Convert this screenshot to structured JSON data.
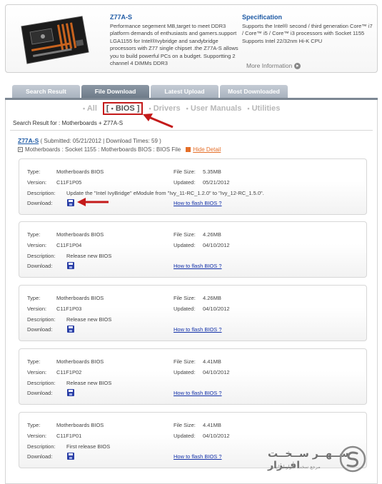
{
  "product": {
    "name": "Z77A-S",
    "description": "Performance segement MB,target to meet DDR3 platform demands of enthusiasts and gamers.support LGA1155 for Intel®Ivybridge and sandybridge processors with Z77 single chipset .the Z77A-S allows you to build powerful PCs on a budget. Supportting 2 channel 4 DIMMs DDR3",
    "spec_title": "Specification",
    "spec_text": "Supports the Intel® second / third generation Core™ i7 / Core™ i5 / Core™ i3 processors with Socket 1155 Supports Intel 22/32nm Hi-K CPU",
    "more_info": "More Information"
  },
  "tabs": [
    "Search Result",
    "File Download",
    "Latest Upload",
    "Most Downloaded"
  ],
  "active_tab": "File Download",
  "filters": {
    "all": "All",
    "bios": "BIOS",
    "drivers": "Drivers",
    "manuals": "User Manuals",
    "utilities": "Utilities",
    "bullet": "•",
    "bracket_open": "[",
    "bracket_close": "]"
  },
  "search_result_text": "Search Result for : Motherboards + Z77A-S",
  "model": {
    "name": "Z77A-S",
    "meta": "( Submitted: 05/21/2012  |  Download Times: 59 )",
    "breadcrumb": "Motherboards : Socket 1155 : Motherboards BIOS : BIOS File",
    "hide_detail": "Hide Detail"
  },
  "labels": {
    "type": "Type:",
    "version": "Version:",
    "description": "Description:",
    "download": "Download:",
    "file_size": "File Size:",
    "updated": "Updated:",
    "flash": "How to flash BIOS ?"
  },
  "bios_files": [
    {
      "type": "Motherboards BIOS",
      "version": "C11F1P05",
      "description": "Update the \"Intel IvyBridge\" eModule from \"Ivy_11-RC_1.2.0\" to \"Ivy_12-RC_1.5.0\".",
      "size": "5.35MB",
      "updated": "05/21/2012"
    },
    {
      "type": "Motherboards BIOS",
      "version": "C11F1P04",
      "description": "Release new BIOS",
      "size": "4.26MB",
      "updated": "04/10/2012"
    },
    {
      "type": "Motherboards BIOS",
      "version": "C11F1P03",
      "description": "Release new BIOS",
      "size": "4.26MB",
      "updated": "04/10/2012"
    },
    {
      "type": "Motherboards BIOS",
      "version": "C11F1P02",
      "description": "Release new BIOS",
      "size": "4.41MB",
      "updated": "04/10/2012"
    },
    {
      "type": "Motherboards BIOS",
      "version": "C11F1P01",
      "description": "First release BIOS",
      "size": "4.41MB",
      "updated": "04/10/2012"
    }
  ],
  "watermark": {
    "title": "ســهــر ســخــت افــزار",
    "subtitle": "مرجع سخت افزار ایرانیان"
  },
  "colors": {
    "link_blue": "#1e5aa5",
    "highlight_red": "#c41a1a",
    "hide_orange": "#e46e28"
  }
}
